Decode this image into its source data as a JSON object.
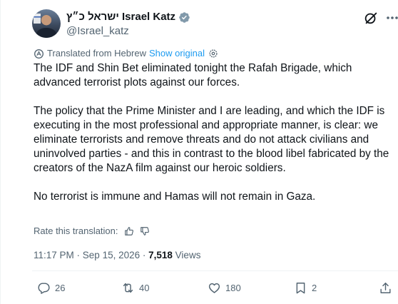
{
  "author": {
    "display_name": "ישראל כ״ץ Israel Katz",
    "handle": "@Israel_katz"
  },
  "translation": {
    "label": "Translated from Hebrew",
    "show_original": "Show original"
  },
  "post": {
    "paragraphs": [
      "The IDF and Shin Bet eliminated tonight the Rafah Brigade, which advanced terrorist plots against our forces.",
      "The policy that the Prime Minister and I are leading, and which the IDF is executing in the most professional and appropriate manner, is clear: we eliminate terrorists and remove threats and do not attack civilians and uninvolved parties - and this in contrast to the blood libel fabricated by the creators of the NazA film against our heroic soldiers.",
      "No terrorist is immune and Hamas will not remain in Gaza."
    ]
  },
  "rate": {
    "label": "Rate this translation:"
  },
  "meta": {
    "time": "11:17 PM",
    "separator": " · ",
    "date": "Sep 15, 2026",
    "separator2": " · ",
    "views_count": "7,518",
    "views_label": " Views"
  },
  "actions": {
    "replies": "26",
    "reposts": "40",
    "likes": "180",
    "bookmarks": "2"
  },
  "icons": {
    "verified": "verified-badge-icon",
    "grok": "grok-icon",
    "more": "more-icon",
    "translate": "translate-icon",
    "settings": "gear-icon",
    "thumbs_up": "thumbs-up-icon",
    "thumbs_down": "thumbs-down-icon",
    "reply": "reply-icon",
    "repost": "repost-icon",
    "like": "heart-icon",
    "bookmark": "bookmark-icon",
    "share": "share-icon"
  },
  "colors": {
    "text": "#0f1419",
    "secondary": "#536471",
    "link": "#1d9bf0",
    "verified": "#1d9bf0",
    "divider": "#eff3f4"
  }
}
